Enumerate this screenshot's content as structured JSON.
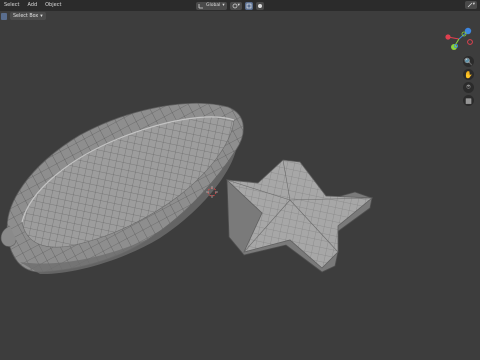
{
  "menubar": {
    "items": [
      "Select",
      "Add",
      "Object"
    ]
  },
  "header": {
    "orientation_label": "Global",
    "icons": [
      "transform-orientation-icon",
      "pivot-icon",
      "snap-icon",
      "proportional-edit-icon"
    ]
  },
  "toolbar": {
    "select_mode_label": "Select Box"
  },
  "gizmo": {
    "axes": [
      {
        "name": "x",
        "color": "#e0404f"
      },
      {
        "name": "y",
        "color": "#8cd33c"
      },
      {
        "name": "z",
        "color": "#3d86e0"
      }
    ]
  },
  "nav": {
    "buttons": [
      "zoom-icon",
      "hand-pan-icon",
      "camera-icon",
      "grid-view-icon"
    ]
  },
  "scene": {
    "objects": [
      "pod-shell-mesh",
      "star-mesh",
      "3d-cursor"
    ]
  }
}
